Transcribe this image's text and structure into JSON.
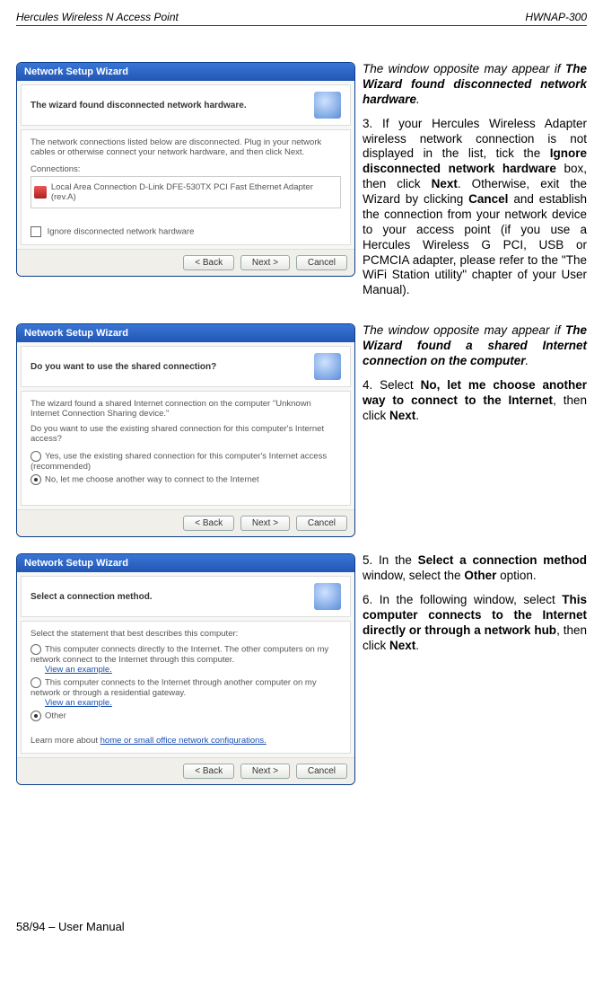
{
  "header": {
    "left": "Hercules Wireless N Access Point",
    "right": "HWNAP-300"
  },
  "wizard": {
    "title": "Network Setup Wizard",
    "buttons": {
      "back": "< Back",
      "next": "Next >",
      "cancel": "Cancel"
    },
    "win1": {
      "subtitle": "The wizard found disconnected network hardware.",
      "desc": "The network connections listed below are disconnected. Plug in your network cables or otherwise connect your network hardware, and then click Next.",
      "connLabel": "Connections:",
      "connItem": "Local Area Connection   D-Link DFE-530TX PCI Fast Ethernet Adapter (rev.A)",
      "ignore": "Ignore disconnected network hardware"
    },
    "win2": {
      "subtitle": "Do you want to use the shared connection?",
      "desc1": "The wizard found a shared Internet connection on the computer \"Unknown Internet Connection Sharing device.\"",
      "desc2": "Do you want to use the existing shared connection for this computer's Internet access?",
      "opt1": "Yes, use the existing shared connection for this computer's Internet access (recommended)",
      "opt2": "No, let me choose another way to connect to the Internet"
    },
    "win3": {
      "subtitle": "Select a connection method.",
      "desc": "Select the statement that best describes this computer:",
      "opt1a": "This computer connects directly to the Internet. The other computers on my network connect to the Internet through this computer.",
      "opt2a": "This computer connects to the Internet through another computer on my network or through a residential gateway.",
      "view": "View an example.",
      "opt3a": "Other",
      "learn": "Learn more about ",
      "learnLink": "home or small office network configurations."
    }
  },
  "text": {
    "p1a": "The window opposite may appear if ",
    "p1b": "The Wizard found disconnected network hardware",
    "p1c": ".",
    "p2": "3. If your Hercules Wireless Adapter wireless network connection is not displayed in the list, tick the ",
    "p2b1": "Ignore disconnected network hardware",
    "p2m": " box, then click ",
    "p2b2": "Next",
    "p2m2": ".  Otherwise, exit the Wizard by clicking ",
    "p2b3": "Cancel",
    "p2m3": " and establish the connection from your network device to your access point (if you use a Hercules Wireless G PCI, USB or PCMCIA adapter, please refer to the \"The WiFi Station utility\" chapter of your User Manual).",
    "p3a": "The window opposite may appear if ",
    "p3b": "The Wizard found a shared Internet connection on the computer",
    "p3c": ".",
    "p4": "4. Select ",
    "p4b": "No, let me choose another way to connect to the Internet",
    "p4m": ", then click ",
    "p4b2": "Next",
    "p4e": ".",
    "p5": "5. In the ",
    "p5b": "Select a connection method",
    "p5m": " window, select the ",
    "p5b2": "Other",
    "p5e": " option.",
    "p6": "6. In the following window, select ",
    "p6b": "This computer connects to the Internet directly or through a network hub",
    "p6m": ", then click ",
    "p6b2": "Next",
    "p6e": "."
  },
  "footer": "58/94 – User Manual"
}
